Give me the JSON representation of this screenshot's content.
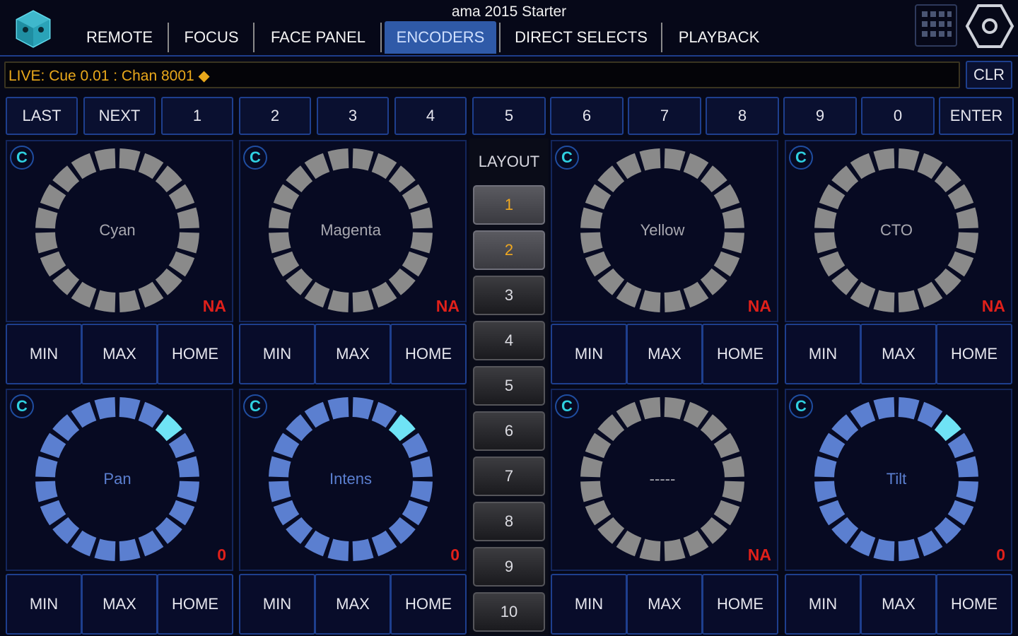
{
  "app": {
    "title": "ama 2015 Starter"
  },
  "tabs": [
    {
      "label": "REMOTE"
    },
    {
      "label": "FOCUS"
    },
    {
      "label": "FACE PANEL"
    },
    {
      "label": "ENCODERS",
      "active": true
    },
    {
      "label": "DIRECT SELECTS"
    },
    {
      "label": "PLAYBACK"
    }
  ],
  "header": {
    "menu_icon": "grid-icon",
    "settings_icon": "gear-icon"
  },
  "command_line": {
    "text": "LIVE: Cue  0.01 : Chan 8001 ◆",
    "clear_label": "CLR"
  },
  "keypad": [
    "LAST",
    "NEXT",
    "1",
    "2",
    "3",
    "4",
    "5",
    "6",
    "7",
    "8",
    "9",
    "0",
    "ENTER"
  ],
  "layout": {
    "label": "LAYOUT",
    "buttons": [
      "1",
      "2",
      "3",
      "4",
      "5",
      "6",
      "7",
      "8",
      "9",
      "10"
    ],
    "selected": [
      "1",
      "2"
    ]
  },
  "encoders": [
    {
      "c_label": "C",
      "name": "Cyan",
      "value": "NA",
      "active": false,
      "level": null
    },
    {
      "c_label": "C",
      "name": "Magenta",
      "value": "NA",
      "active": false,
      "level": null
    },
    {
      "c_label": "C",
      "name": "Yellow",
      "value": "NA",
      "active": false,
      "level": null
    },
    {
      "c_label": "C",
      "name": "CTO",
      "value": "NA",
      "active": false,
      "level": null
    },
    {
      "c_label": "C",
      "name": "Pan",
      "value": "0",
      "active": true,
      "level": 0
    },
    {
      "c_label": "C",
      "name": "Intens",
      "value": "0",
      "active": true,
      "level": 0
    },
    {
      "c_label": "C",
      "name": "-----",
      "value": "NA",
      "active": false,
      "level": null
    },
    {
      "c_label": "C",
      "name": "Tilt",
      "value": "0",
      "active": true,
      "level": 0
    }
  ],
  "encoder_buttons": {
    "min": "MIN",
    "max": "MAX",
    "home": "HOME"
  },
  "colors": {
    "accent": "#2f5aa8",
    "ring_inactive": "#8a8a8a",
    "ring_active": "#5b7fd0",
    "ring_indicator": "#6fe3f5",
    "value_red": "#e0201a",
    "command_text": "#e9a81b",
    "c_button": "#2fd0e0"
  }
}
